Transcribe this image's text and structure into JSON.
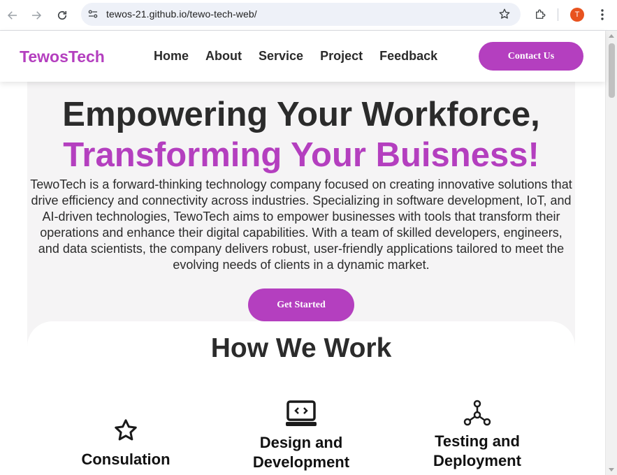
{
  "browser": {
    "url": "tewos-21.github.io/tewo-tech-web/",
    "profile_initial": "T"
  },
  "header": {
    "logo": "TewosTech",
    "nav": [
      "Home",
      "About",
      "Service",
      "Project",
      "Feedback"
    ],
    "contact_label": "Contact Us"
  },
  "hero": {
    "title_line1": "Empowering Your Workforce,",
    "title_line2": "Transforming Your Buisness!",
    "description": "TewoTech is a forward-thinking technology company focused on creating innovative solutions that drive efficiency and connectivity across industries. Specializing in software development, IoT, and AI-driven technologies, TewoTech aims to empower businesses with tools that transform their operations and enhance their digital capabilities. With a team of skilled developers, engineers, and data scientists, the company delivers robust, user-friendly applications tailored to meet the evolving needs of clients in a dynamic market.",
    "cta_label": "Get Started"
  },
  "how_we_work": {
    "title": "How We Work",
    "steps": [
      {
        "label": "Consulation",
        "icon": "star-icon"
      },
      {
        "label": "Design and Development",
        "icon": "laptop-code-icon"
      },
      {
        "label": "Testing and Deployment",
        "icon": "network-icon"
      }
    ]
  },
  "colors": {
    "brand": "#b43fbf",
    "text": "#2b2b2b",
    "hero_bg": "#f5f4f5"
  }
}
